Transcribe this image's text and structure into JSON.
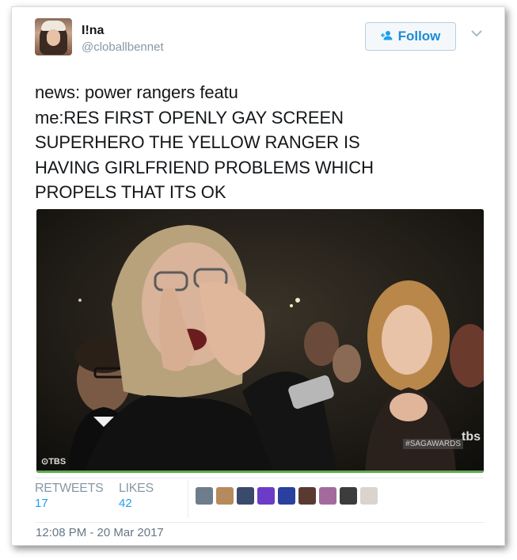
{
  "user": {
    "display_name": "I!na",
    "handle": "@cloballbennet"
  },
  "follow_button": {
    "label": "Follow"
  },
  "tweet": {
    "lines": [
      "news: power rangers featu",
      "me:RES FIRST OPENLY GAY SCREEN",
      "SUPERHERO THE YELLOW RANGER IS",
      "HAVING GIRLFRIEND PROBLEMS WHICH",
      "PROPELS THAT ITS OK"
    ]
  },
  "media": {
    "watermark_left": "⊙TBS",
    "watermark_right": "#SAGAWARDS",
    "watermark_corner": "tbs"
  },
  "stats": {
    "retweets_label": "RETWEETS",
    "retweets_count": "17",
    "likes_label": "LIKES",
    "likes_count": "42"
  },
  "liker_colors": [
    "#6d7d8c",
    "#b58a5c",
    "#3a4a6a",
    "#6c3cc8",
    "#2a3f9e",
    "#5a3a30",
    "#a36b9d",
    "#3c3c3c",
    "#d9d4ce"
  ],
  "timestamp": "12:08 PM - 20 Mar 2017"
}
